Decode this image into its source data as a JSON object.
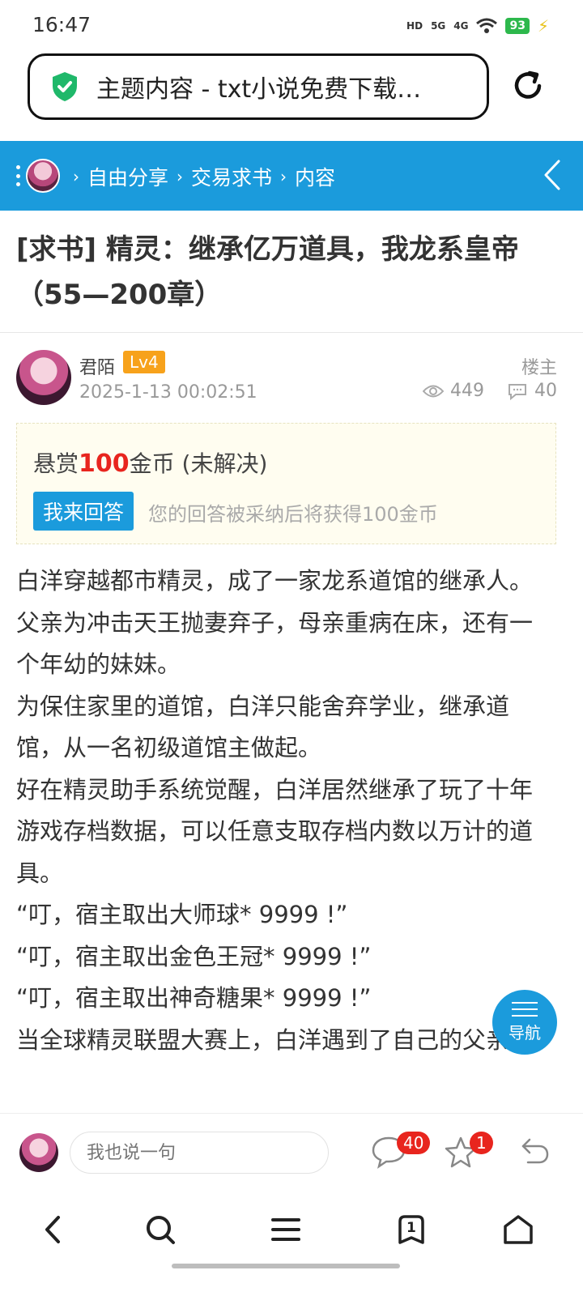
{
  "status": {
    "time": "16:47",
    "network1": "HD",
    "network2": "5G",
    "network3": "4G",
    "battery": "93"
  },
  "browser": {
    "tab_title": "主题内容 - txt小说免费下载…"
  },
  "breadcrumb": {
    "items": [
      "自由分享",
      "交易求书",
      "内容"
    ]
  },
  "post": {
    "title": "[求书] 精灵：继承亿万道具，我龙系皇帝（55—200章）",
    "author": "君陌",
    "level": "Lv4",
    "time": "2025-1-13 00:02:51",
    "owner_label": "楼主",
    "views": "449",
    "replies": "40"
  },
  "reward": {
    "prefix": "悬赏",
    "amount": "100",
    "suffix": "金币 (未解决)",
    "answer_button": "我来回答",
    "hint": "您的回答被采纳后将获得100金币"
  },
  "content": [
    "白洋穿越都市精灵，成了一家龙系道馆的继承人。",
    "父亲为冲击天王抛妻弃子，母亲重病在床，还有一个年幼的妹妹。",
    "为保住家里的道馆，白洋只能舍弃学业，继承道馆，从一名初级道馆主做起。",
    "好在精灵助手系统觉醒，白洋居然继承了玩了十年游戏存档数据，可以任意支取存档内数以万计的道具。",
    "“叮，宿主取出大师球* 9999 !”",
    "“叮，宿主取出金色王冠* 9999 !”",
    "“叮，宿主取出神奇糖果* 9999 !”",
    "当全球精灵联盟大赛上，白洋遇到了自己的父亲"
  ],
  "float_nav": {
    "label": "导航"
  },
  "reply_bar": {
    "placeholder": "我也说一句",
    "comment_count": "40",
    "favorite_count": "1"
  },
  "bottom_nav": {
    "tab_count": "1"
  },
  "colors": {
    "accent": "#1b9bdc",
    "reward_red": "#e8251e",
    "level_orange": "#f7a21b"
  }
}
